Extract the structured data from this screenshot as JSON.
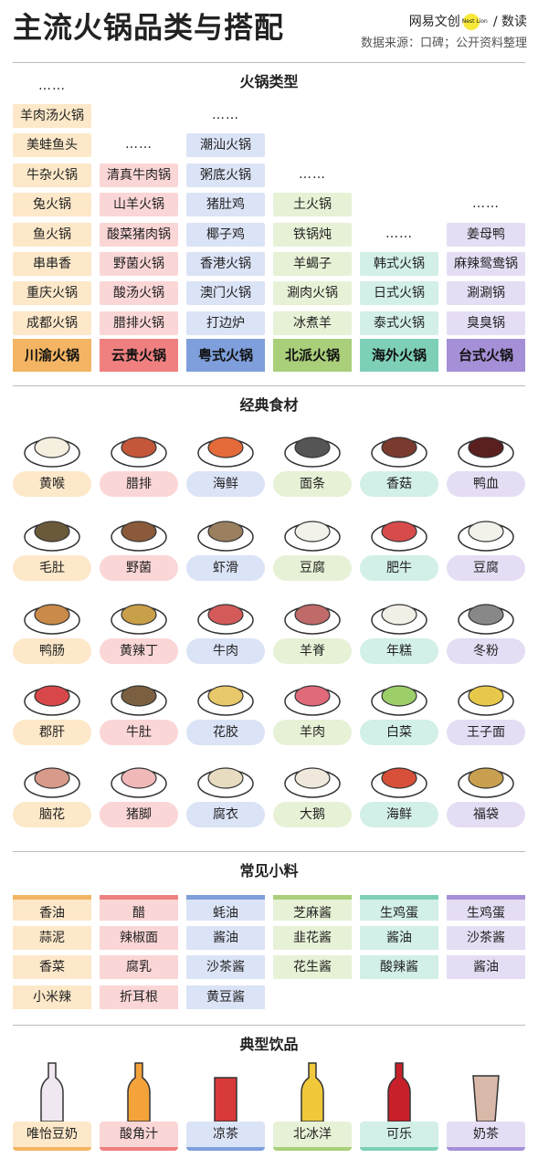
{
  "header": {
    "title": "主流火锅品类与搭配",
    "brand_left": "网易文创",
    "brand_badge": "Nest Lion",
    "brand_right": "/ 数读",
    "source": "数据来源：口碑；公开资料整理"
  },
  "colors": {
    "c0": "#fde8c9",
    "c0h": "#f3b463",
    "c1": "#fbd6d6",
    "c1h": "#f08080",
    "c2": "#dbe3f6",
    "c2h": "#7e9fdb",
    "c3": "#e7f1d6",
    "c3h": "#a9cf7a",
    "c4": "#d2efe8",
    "c4h": "#7dcfb8",
    "c5": "#e5ddf4",
    "c5h": "#a58fd6"
  },
  "hotpot": {
    "title": "火锅类型",
    "ellipsis": "……",
    "columns": [
      {
        "header": "川渝火锅",
        "items": [
          "羊肉汤火锅",
          "美蛙鱼头",
          "牛杂火锅",
          "兔火锅",
          "鱼火锅",
          "串串香",
          "重庆火锅",
          "成都火锅"
        ]
      },
      {
        "header": "云贵火锅",
        "items": [
          "清真牛肉锅",
          "山羊火锅",
          "酸菜猪肉锅",
          "野菌火锅",
          "酸汤火锅",
          "腊排火锅"
        ]
      },
      {
        "header": "粤式火锅",
        "items": [
          "潮汕火锅",
          "粥底火锅",
          "猪肚鸡",
          "椰子鸡",
          "香港火锅",
          "澳门火锅",
          "打边炉"
        ]
      },
      {
        "header": "北派火锅",
        "items": [
          "土火锅",
          "铁锅炖",
          "羊蝎子",
          "涮肉火锅",
          "冰煮羊"
        ]
      },
      {
        "header": "海外火锅",
        "items": [
          "韩式火锅",
          "日式火锅",
          "泰式火锅"
        ]
      },
      {
        "header": "台式火锅",
        "items": [
          "姜母鸭",
          "麻辣鸳鸯锅",
          "涮涮锅",
          "臭臭锅"
        ]
      }
    ]
  },
  "ingredients": {
    "title": "经典食材",
    "rows": [
      [
        "黄喉",
        "腊排",
        "海鲜",
        "面条",
        "香菇",
        "鸭血"
      ],
      [
        "毛肚",
        "野菌",
        "虾滑",
        "豆腐",
        "肥牛",
        "豆腐"
      ],
      [
        "鸭肠",
        "黄辣丁",
        "牛肉",
        "羊脊",
        "年糕",
        "冬粉"
      ],
      [
        "郡肝",
        "牛肚",
        "花胶",
        "羊肉",
        "白菜",
        "王子面"
      ],
      [
        "脑花",
        "猪脚",
        "腐衣",
        "大鹅",
        "海鲜",
        "福袋"
      ]
    ]
  },
  "condiments": {
    "title": "常见小料",
    "columns": [
      [
        "香油",
        "蒜泥",
        "香菜",
        "小米辣"
      ],
      [
        "醋",
        "辣椒面",
        "腐乳",
        "折耳根"
      ],
      [
        "蚝油",
        "酱油",
        "沙茶酱",
        "黄豆酱"
      ],
      [
        "芝麻酱",
        "韭花酱",
        "花生酱"
      ],
      [
        "生鸡蛋",
        "酱油",
        "酸辣酱"
      ],
      [
        "生鸡蛋",
        "沙茶酱",
        "酱油"
      ]
    ]
  },
  "drinks": {
    "title": "典型饮品",
    "items": [
      "唯怡豆奶",
      "酸角汁",
      "凉茶",
      "北冰洋",
      "可乐",
      "奶茶"
    ]
  }
}
